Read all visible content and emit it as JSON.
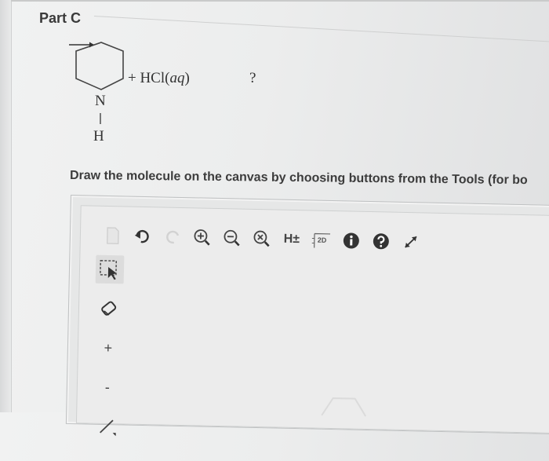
{
  "part": {
    "title": "Part C"
  },
  "reaction": {
    "atom_n": "N",
    "atom_h": "H",
    "plus_reagent": "+ HCl(",
    "reagent_state": "aq",
    "close_paren": ")",
    "product": "?"
  },
  "instruction": "Draw the molecule on the canvas by choosing buttons from the Tools (for bo",
  "toolbar": {
    "icons": [
      "new-icon",
      "undo-icon",
      "redo-icon",
      "zoom-in-icon",
      "zoom-out-icon",
      "zoom-reset-icon",
      "h-toggle-icon",
      "2d-clean-icon",
      "info-icon",
      "help-icon",
      "expand-icon"
    ],
    "h_label": "H±",
    "clean_label": "2D"
  },
  "sidebar": {
    "icons": [
      "select-icon",
      "eraser-icon",
      "plus-charge-icon",
      "minus-charge-icon",
      "single-bond-icon"
    ],
    "plus_label": "+",
    "minus_label": "-"
  },
  "colors": {
    "background": "#eceded",
    "text": "#2b2b2b",
    "info_icon": "#333333"
  }
}
